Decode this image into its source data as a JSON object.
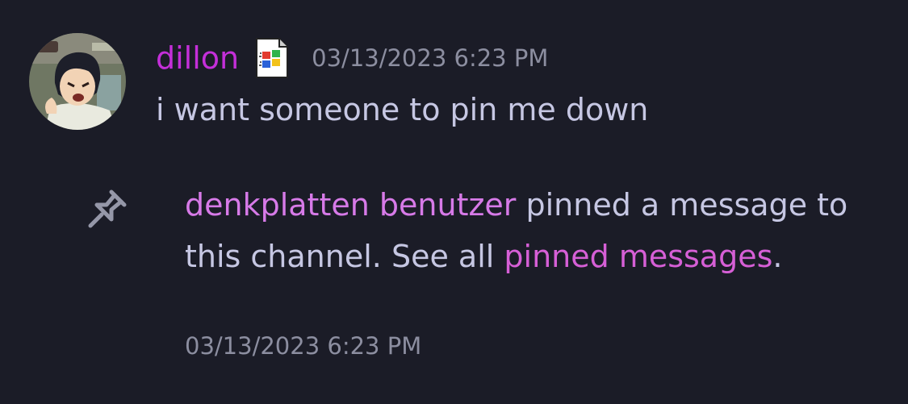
{
  "message": {
    "author": "dillon",
    "badge_icon": "windows-file-icon",
    "timestamp": "03/13/2023 6:23 PM",
    "content": "i want someone to pin me down"
  },
  "system_message": {
    "icon": "pin-icon",
    "pinner": "denkplatten benutzer",
    "text_middle": " pinned a message to this channel. See all ",
    "link_text": "pinned messages",
    "text_end": ".",
    "timestamp": "03/13/2023 6:23 PM"
  },
  "colors": {
    "background": "#1b1c27",
    "username": "#c42fd9",
    "pinner": "#d77ae8",
    "link": "#d65fd6",
    "text": "#c6c7e3",
    "timestamp": "#8c8ea0"
  }
}
